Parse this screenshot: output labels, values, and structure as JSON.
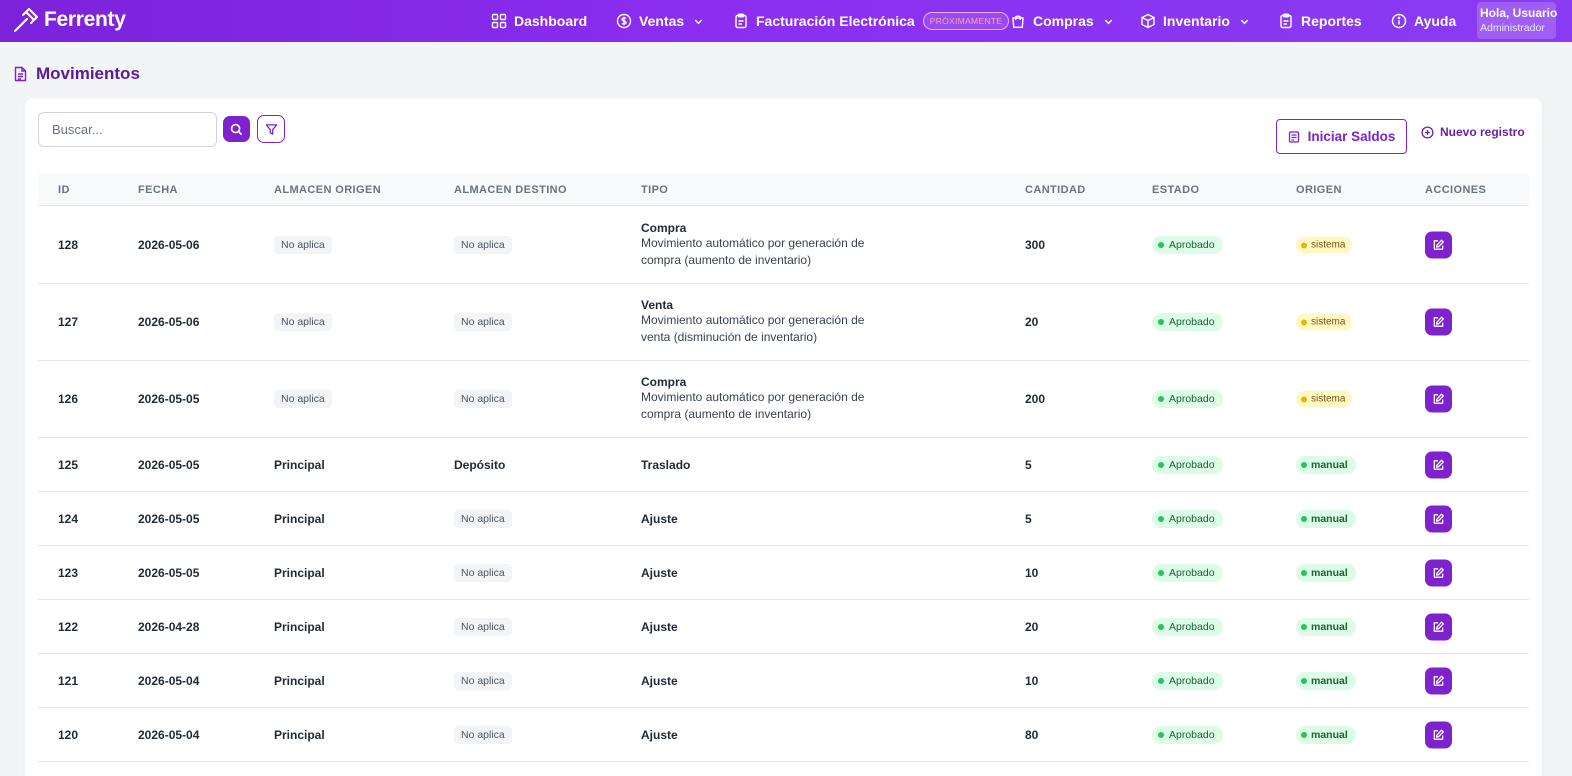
{
  "app": {
    "brand": "Ferrenty",
    "nav": [
      {
        "label": "Dashboard",
        "icon": "grid-icon"
      },
      {
        "label": "Ventas",
        "icon": "dollar-circle-icon",
        "dropdown": true
      },
      {
        "label": "Facturación Electrónica",
        "icon": "clipboard-icon",
        "badge": "PRÓXIMAMENTE"
      },
      {
        "label": "Compras",
        "icon": "bag-icon",
        "dropdown": true
      },
      {
        "label": "Inventario",
        "icon": "box-icon",
        "dropdown": true
      },
      {
        "label": "Reportes",
        "icon": "clipboard-icon"
      },
      {
        "label": "Ayuda",
        "icon": "info-icon"
      }
    ],
    "user": {
      "greeting": "Hola, Usuario",
      "role": "Administrador"
    }
  },
  "page": {
    "title": "Movimientos"
  },
  "toolbar": {
    "search_placeholder": "Buscar...",
    "iniciar_saldos": "Iniciar Saldos",
    "nuevo_registro": "Nuevo registro"
  },
  "table": {
    "columns": [
      "ID",
      "FECHA",
      "ALMACEN ORIGEN",
      "ALMACEN DESTINO",
      "TIPO",
      "CANTIDAD",
      "ESTADO",
      "ORIGEN",
      "ACCIONES"
    ],
    "rows": [
      {
        "id": "128",
        "fecha": "2026-05-06",
        "origen_alm": "No aplica",
        "destino_alm": "No aplica",
        "tipo": "Compra",
        "descripcion": "Movimiento automático por generación de compra (aumento de inventario)",
        "cantidad": "300",
        "estado": "Aprobado",
        "origen": "sistema"
      },
      {
        "id": "127",
        "fecha": "2026-05-06",
        "origen_alm": "No aplica",
        "destino_alm": "No aplica",
        "tipo": "Venta",
        "descripcion": "Movimiento automático por generación de venta (disminución de inventario)",
        "cantidad": "20",
        "estado": "Aprobado",
        "origen": "sistema"
      },
      {
        "id": "126",
        "fecha": "2026-05-05",
        "origen_alm": "No aplica",
        "destino_alm": "No aplica",
        "tipo": "Compra",
        "descripcion": "Movimiento automático por generación de compra (aumento de inventario)",
        "cantidad": "200",
        "estado": "Aprobado",
        "origen": "sistema"
      },
      {
        "id": "125",
        "fecha": "2026-05-05",
        "origen_alm": "Principal",
        "destino_alm": "Depósito",
        "tipo": "Traslado",
        "descripcion": "",
        "cantidad": "5",
        "estado": "Aprobado",
        "origen": "manual"
      },
      {
        "id": "124",
        "fecha": "2026-05-05",
        "origen_alm": "Principal",
        "destino_alm": "No aplica",
        "tipo": "Ajuste",
        "descripcion": "",
        "cantidad": "5",
        "estado": "Aprobado",
        "origen": "manual"
      },
      {
        "id": "123",
        "fecha": "2026-05-05",
        "origen_alm": "Principal",
        "destino_alm": "No aplica",
        "tipo": "Ajuste",
        "descripcion": "",
        "cantidad": "10",
        "estado": "Aprobado",
        "origen": "manual"
      },
      {
        "id": "122",
        "fecha": "2026-04-28",
        "origen_alm": "Principal",
        "destino_alm": "No aplica",
        "tipo": "Ajuste",
        "descripcion": "",
        "cantidad": "20",
        "estado": "Aprobado",
        "origen": "manual"
      },
      {
        "id": "121",
        "fecha": "2026-05-04",
        "origen_alm": "Principal",
        "destino_alm": "No aplica",
        "tipo": "Ajuste",
        "descripcion": "",
        "cantidad": "10",
        "estado": "Aprobado",
        "origen": "manual"
      },
      {
        "id": "120",
        "fecha": "2026-05-04",
        "origen_alm": "Principal",
        "destino_alm": "No aplica",
        "tipo": "Ajuste",
        "descripcion": "",
        "cantidad": "80",
        "estado": "Aprobado",
        "origen": "manual"
      }
    ]
  },
  "colors": {
    "brand_purple": "#7e22ce",
    "nav_gradient_start": "#7c22d9",
    "nav_gradient_end": "#8a3cf2",
    "status_green": "#22c55e",
    "status_amber": "#eab308"
  }
}
